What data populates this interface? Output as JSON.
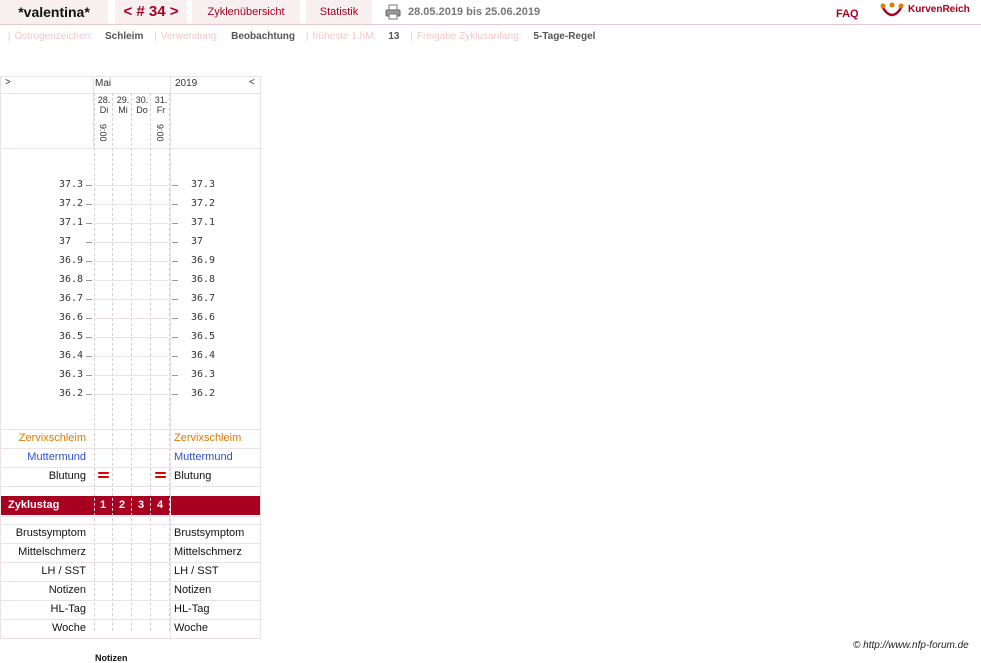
{
  "header": {
    "user": "*valentina*",
    "cycle": "< # 34 >",
    "tab_overview": "Zyklenübersicht",
    "tab_stats": "Statistik",
    "date_range": "28.05.2019 bis 25.06.2019",
    "faq": "FAQ",
    "logo": "KurvenReich",
    "icon_print": "printer-icon",
    "icon_logo": "kurvenreich-logo-icon"
  },
  "info": {
    "estrogen_label": "Östrogenzeichen:",
    "estrogen_value": "Schleim",
    "usage_label": "Verwendung:",
    "usage_value": "Beobachtung",
    "first_hm_label": "früheste 1.hM:",
    "first_hm_value": "13",
    "release_label": "Freigabe Zyklusanfang:",
    "release_value": "5-Tage-Regel"
  },
  "chart": {
    "nav_left": ">",
    "nav_right": "<",
    "month": "Mai",
    "year": "2019",
    "days": [
      {
        "date": "28.",
        "weekday": "Di",
        "time": "9:00",
        "cycle_day": "1",
        "bleeding": true
      },
      {
        "date": "29.",
        "weekday": "Mi",
        "time": "",
        "cycle_day": "2",
        "bleeding": false
      },
      {
        "date": "30.",
        "weekday": "Do",
        "time": "",
        "cycle_day": "3",
        "bleeding": false
      },
      {
        "date": "31.",
        "weekday": "Fr",
        "time": "9:00",
        "cycle_day": "4",
        "bleeding": true
      }
    ],
    "temps": [
      "37.3",
      "37.2",
      "37.1",
      "37",
      "36.9",
      "36.8",
      "36.7",
      "36.6",
      "36.5",
      "36.4",
      "36.3",
      "36.2"
    ],
    "rows_top": [
      "Zervixschleim",
      "Muttermund",
      "Blutung"
    ],
    "zyklustag": "Zyklustag",
    "rows_bottom": [
      "Brustsymptom",
      "Mittelschmerz",
      "LH / SST",
      "Notizen",
      "HL-Tag",
      "Woche"
    ],
    "colors": {
      "zervix": "#e07a00",
      "muttermund": "#3050c8",
      "accent": "#a80020",
      "bleeding": "#dd0000"
    }
  },
  "footer": {
    "copyright": "© http://www.nfp-forum.de",
    "notizen": "Notizen"
  }
}
